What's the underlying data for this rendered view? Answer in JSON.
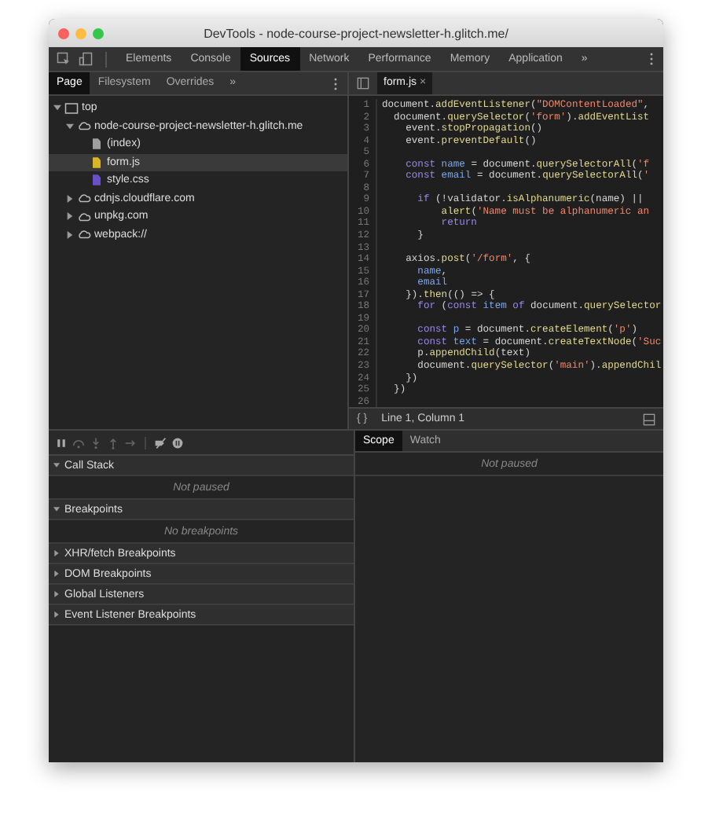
{
  "window": {
    "title": "DevTools - node-course-project-newsletter-h.glitch.me/"
  },
  "main_tabs": [
    {
      "label": "Elements",
      "selected": false
    },
    {
      "label": "Console",
      "selected": false
    },
    {
      "label": "Sources",
      "selected": true
    },
    {
      "label": "Network",
      "selected": false
    },
    {
      "label": "Performance",
      "selected": false
    },
    {
      "label": "Memory",
      "selected": false
    },
    {
      "label": "Application",
      "selected": false
    }
  ],
  "main_more": "»",
  "navigator": {
    "tabs": [
      {
        "label": "Page",
        "selected": true
      },
      {
        "label": "Filesystem",
        "selected": false
      },
      {
        "label": "Overrides",
        "selected": false
      }
    ],
    "more": "»",
    "tree": [
      {
        "label": "top",
        "kind": "frame",
        "expanded": true,
        "selected": false,
        "children": [
          {
            "label": "node-course-project-newsletter-h.glitch.me",
            "kind": "domain",
            "expanded": true,
            "selected": false,
            "children": [
              {
                "label": "(index)",
                "kind": "file",
                "color": "#9e9e9e",
                "selected": false
              },
              {
                "label": "form.js",
                "kind": "file",
                "color": "#d8b62a",
                "selected": true
              },
              {
                "label": "style.css",
                "kind": "file",
                "color": "#6a4fc8",
                "selected": false
              }
            ]
          },
          {
            "label": "cdnjs.cloudflare.com",
            "kind": "domain",
            "expanded": false,
            "selected": false
          },
          {
            "label": "unpkg.com",
            "kind": "domain",
            "expanded": false,
            "selected": false
          },
          {
            "label": "webpack://",
            "kind": "domain",
            "expanded": false,
            "selected": false
          }
        ]
      }
    ]
  },
  "editor": {
    "tabs": [
      {
        "label": "form.js",
        "close": "×",
        "selected": true
      }
    ],
    "lines": [
      {
        "number": "1",
        "tokens": [
          {
            "kind": "plain",
            "text": "document."
          },
          {
            "kind": "method",
            "text": "addEventListener"
          },
          {
            "kind": "plain",
            "text": "("
          },
          {
            "kind": "string",
            "text": "\"DOMContentLoaded\""
          },
          {
            "kind": "plain",
            "text": ","
          }
        ]
      },
      {
        "number": "2",
        "tokens": [
          {
            "kind": "plain",
            "text": "  document."
          },
          {
            "kind": "method",
            "text": "querySelector"
          },
          {
            "kind": "plain",
            "text": "("
          },
          {
            "kind": "string",
            "text": "'form'"
          },
          {
            "kind": "plain",
            "text": ")."
          },
          {
            "kind": "method",
            "text": "addEventList"
          }
        ]
      },
      {
        "number": "3",
        "tokens": [
          {
            "kind": "plain",
            "text": "    event."
          },
          {
            "kind": "method",
            "text": "stopPropagation"
          },
          {
            "kind": "plain",
            "text": "()"
          }
        ]
      },
      {
        "number": "4",
        "tokens": [
          {
            "kind": "plain",
            "text": "    event."
          },
          {
            "kind": "method",
            "text": "preventDefault"
          },
          {
            "kind": "plain",
            "text": "()"
          }
        ]
      },
      {
        "number": "5"
      },
      {
        "number": "6",
        "tokens": [
          {
            "kind": "keyword",
            "text": "    const"
          },
          {
            "kind": "var",
            "text": " name"
          },
          {
            "kind": "plain",
            "text": " = document."
          },
          {
            "kind": "method",
            "text": "querySelectorAll"
          },
          {
            "kind": "plain",
            "text": "("
          },
          {
            "kind": "string",
            "text": "'f"
          }
        ]
      },
      {
        "number": "7",
        "tokens": [
          {
            "kind": "keyword",
            "text": "    const"
          },
          {
            "kind": "var",
            "text": " email"
          },
          {
            "kind": "plain",
            "text": " = document."
          },
          {
            "kind": "method",
            "text": "querySelectorAll"
          },
          {
            "kind": "plain",
            "text": "("
          },
          {
            "kind": "string",
            "text": "'"
          }
        ]
      },
      {
        "number": "8"
      },
      {
        "number": "9",
        "tokens": [
          {
            "kind": "keyword",
            "text": "      if"
          },
          {
            "kind": "plain",
            "text": " (!validator."
          },
          {
            "kind": "method",
            "text": "isAlphanumeric"
          },
          {
            "kind": "plain",
            "text": "(name) ||"
          }
        ]
      },
      {
        "number": "10",
        "tokens": [
          {
            "kind": "method",
            "text": "          alert"
          },
          {
            "kind": "plain",
            "text": "("
          },
          {
            "kind": "string",
            "text": "'Name must be alphanumeric an"
          }
        ]
      },
      {
        "number": "11",
        "tokens": [
          {
            "kind": "keyword",
            "text": "          return"
          }
        ]
      },
      {
        "number": "12",
        "tokens": [
          {
            "kind": "plain",
            "text": "      }"
          }
        ]
      },
      {
        "number": "13"
      },
      {
        "number": "14",
        "tokens": [
          {
            "kind": "plain",
            "text": "    axios."
          },
          {
            "kind": "method",
            "text": "post"
          },
          {
            "kind": "plain",
            "text": "("
          },
          {
            "kind": "string",
            "text": "'/form'"
          },
          {
            "kind": "plain",
            "text": ", {"
          }
        ]
      },
      {
        "number": "15",
        "tokens": [
          {
            "kind": "var",
            "text": "      name"
          },
          {
            "kind": "plain",
            "text": ","
          }
        ]
      },
      {
        "number": "16",
        "tokens": [
          {
            "kind": "var",
            "text": "      email"
          }
        ]
      },
      {
        "number": "17",
        "tokens": [
          {
            "kind": "plain",
            "text": "    })."
          },
          {
            "kind": "method",
            "text": "then"
          },
          {
            "kind": "plain",
            "text": "(() => {"
          }
        ]
      },
      {
        "number": "18",
        "tokens": [
          {
            "kind": "keyword",
            "text": "      for"
          },
          {
            "kind": "plain",
            "text": " ("
          },
          {
            "kind": "keyword",
            "text": "const"
          },
          {
            "kind": "var",
            "text": " item"
          },
          {
            "kind": "keyword",
            "text": " of"
          },
          {
            "kind": "plain",
            "text": " document."
          },
          {
            "kind": "method",
            "text": "querySelector"
          }
        ]
      },
      {
        "number": "19"
      },
      {
        "number": "20",
        "tokens": [
          {
            "kind": "keyword",
            "text": "      const"
          },
          {
            "kind": "var",
            "text": " p"
          },
          {
            "kind": "plain",
            "text": " = document."
          },
          {
            "kind": "method",
            "text": "createElement"
          },
          {
            "kind": "plain",
            "text": "("
          },
          {
            "kind": "string",
            "text": "'p'"
          },
          {
            "kind": "plain",
            "text": ")"
          }
        ]
      },
      {
        "number": "21",
        "tokens": [
          {
            "kind": "keyword",
            "text": "      const"
          },
          {
            "kind": "var",
            "text": " text"
          },
          {
            "kind": "plain",
            "text": " = document."
          },
          {
            "kind": "method",
            "text": "createTextNode"
          },
          {
            "kind": "plain",
            "text": "("
          },
          {
            "kind": "string",
            "text": "'Suc"
          }
        ]
      },
      {
        "number": "22",
        "tokens": [
          {
            "kind": "plain",
            "text": "      p."
          },
          {
            "kind": "method",
            "text": "appendChild"
          },
          {
            "kind": "plain",
            "text": "(text)"
          }
        ]
      },
      {
        "number": "23",
        "tokens": [
          {
            "kind": "plain",
            "text": "      document."
          },
          {
            "kind": "method",
            "text": "querySelector"
          },
          {
            "kind": "plain",
            "text": "("
          },
          {
            "kind": "string",
            "text": "'main'"
          },
          {
            "kind": "plain",
            "text": ")."
          },
          {
            "kind": "method",
            "text": "appendChil"
          }
        ]
      },
      {
        "number": "24",
        "tokens": [
          {
            "kind": "plain",
            "text": "    })"
          }
        ]
      },
      {
        "number": "25",
        "tokens": [
          {
            "kind": "plain",
            "text": "  })"
          }
        ]
      },
      {
        "number": "26"
      }
    ],
    "pretty_print": "{ }",
    "position": "Line 1, Column 1"
  },
  "debugger": {
    "sections": [
      {
        "title": "Call Stack",
        "expanded": true,
        "message": "Not paused"
      },
      {
        "title": "Breakpoints",
        "expanded": true,
        "message": "No breakpoints"
      },
      {
        "title": "XHR/fetch Breakpoints",
        "expanded": false
      },
      {
        "title": "DOM Breakpoints",
        "expanded": false
      },
      {
        "title": "Global Listeners",
        "expanded": false
      },
      {
        "title": "Event Listener Breakpoints",
        "expanded": false
      }
    ],
    "side_tabs": [
      {
        "label": "Scope",
        "selected": true
      },
      {
        "label": "Watch",
        "selected": false
      }
    ],
    "scope_message": "Not paused"
  }
}
